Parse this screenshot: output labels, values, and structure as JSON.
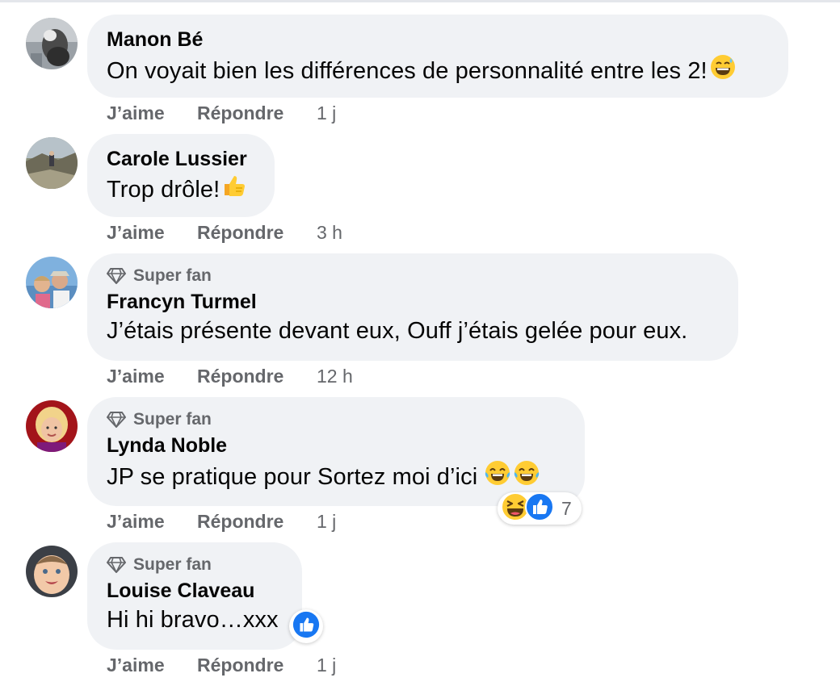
{
  "comments": [
    {
      "author": "Manon Bé",
      "text": "On voyait bien les différences de personnalité entre les 2!",
      "emoji_icons": [
        "grinning-sweat-emoji"
      ],
      "actions": {
        "like": "J’aime",
        "reply": "Répondre",
        "time": "1 j"
      }
    },
    {
      "author": "Carole Lussier",
      "text": "Trop drôle!",
      "emoji_icons": [
        "thumbs-up-emoji"
      ],
      "actions": {
        "like": "J’aime",
        "reply": "Répondre",
        "time": "3 h"
      }
    },
    {
      "badge": "Super fan",
      "author": "Francyn Turmel",
      "text": "J’étais présente devant eux, Ouff j’étais gelée pour eux.",
      "actions": {
        "like": "J’aime",
        "reply": "Répondre",
        "time": "12 h"
      }
    },
    {
      "badge": "Super fan",
      "author": "Lynda Noble",
      "text": "JP se pratique pour Sortez moi d’ici",
      "emoji_icons": [
        "tears-of-joy-emoji",
        "tears-of-joy-emoji"
      ],
      "reactions": {
        "icons": [
          "haha-reaction-icon",
          "like-reaction-icon"
        ],
        "count": "7"
      },
      "actions": {
        "like": "J’aime",
        "reply": "Répondre",
        "time": "1 j"
      }
    },
    {
      "badge": "Super fan",
      "author": "Louise Claveau",
      "text": "Hi hi bravo…xxx",
      "reactions": {
        "icons": [
          "like-reaction-icon"
        ]
      },
      "actions": {
        "like": "J’aime",
        "reply": "Répondre",
        "time": "1 j"
      }
    }
  ],
  "colors": {
    "bubble_bg": "#f0f2f5",
    "secondary_text": "#65676b",
    "primary_text": "#050505",
    "like_blue": "#1877f2",
    "emoji_yellow": "#ffcc33"
  }
}
